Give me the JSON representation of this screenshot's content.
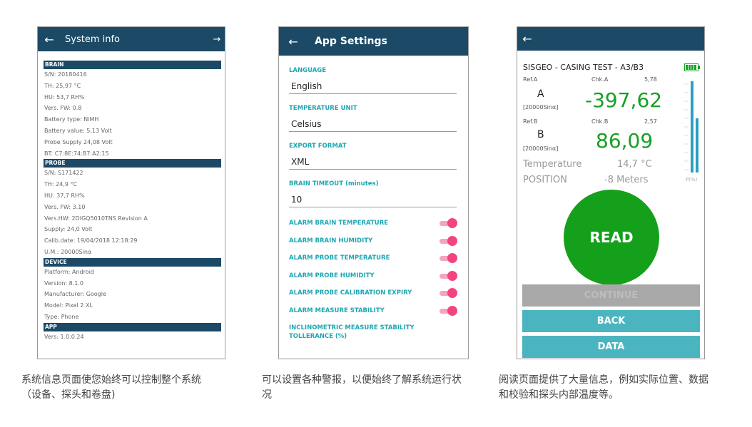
{
  "screen1": {
    "title": "System info",
    "back_icon": "arrow-left-icon",
    "forward_icon": "arrow-right-icon",
    "sections": [
      {
        "header": "BRAIN",
        "rows": [
          "S/N: 20180416",
          "TH: 25,97 °C",
          "HU: 53,7 RH%",
          "Vers. FW: 0.8",
          "Battery type: NiMH",
          "Battery value: 5,13 Volt",
          "Probe Supply 24,08 Volt",
          "BT: C7:8E:74:B7:A2:15"
        ]
      },
      {
        "header": "PROBE",
        "rows": [
          "S/N: S171422",
          "TH: 24,9 °C",
          "HU: 37,7 RH%",
          "Vers. FW: 3.10",
          "Vers.HW: 2DIGQ5010TNS Revision A",
          "Supply: 24,0 Volt",
          "Calib.date: 19/04/2018 12:18:29",
          "U.M.: 20000Sinα"
        ]
      },
      {
        "header": "DEVICE",
        "rows": [
          "Platform: Android",
          "Version: 8.1.0",
          "Manufacturer: Google",
          "Model: Pixel 2 XL",
          "Type: Phone"
        ]
      },
      {
        "header": "APP",
        "rows": [
          "Vers: 1.0.0.24"
        ]
      }
    ]
  },
  "screen2": {
    "title": "App Settings",
    "settings": [
      {
        "label": "LANGUAGE",
        "value": "English"
      },
      {
        "label": "TEMPERATURE UNIT",
        "value": "Celsius"
      },
      {
        "label": "EXPORT FORMAT",
        "value": "XML"
      },
      {
        "label": "BRAIN TIMEOUT (minutes)",
        "value": "10"
      }
    ],
    "alarms": [
      {
        "label": "ALARM BRAIN TEMPERATURE",
        "on": true
      },
      {
        "label": "ALARM BRAIN HUMIDITY",
        "on": true
      },
      {
        "label": "ALARM PROBE TEMPERATURE",
        "on": true
      },
      {
        "label": "ALARM PROBE HUMIDITY",
        "on": true
      },
      {
        "label": "ALARM PROBE CALIBRATION EXPIRY",
        "on": true
      },
      {
        "label": "ALARM MEASURE STABILITY",
        "on": true
      }
    ],
    "inclinometric_label": "INCLINOMETRIC MEASURE STABILITY TOLLERANCE (%)",
    "accent_color": "#1da7b3",
    "toggle_color": "#f2457f"
  },
  "screen3": {
    "header": "SISGEO - CASING TEST - A3/B3",
    "refA": "Ref.A",
    "chkA": "Chk.A",
    "chkA_val": "5,78",
    "axisA": "A",
    "unitA": "[20000Sinα]",
    "valA": "-397,62",
    "refB": "Ref.B",
    "chkB": "Chk.B",
    "chkB_val": "2,57",
    "axisB": "B",
    "unitB": "[20000Sinα]",
    "valB": "86,09",
    "temp_label": "Temperature",
    "temp_val": "14,7 °C",
    "pos_label": "POSITION",
    "pos_val": "-8 Meters",
    "gauge_label": "P(%)",
    "read_label": "READ",
    "continue_label": "CONTINUE",
    "back_label": "BACK",
    "data_label": "DATA",
    "green": "#15a01b",
    "teal": "#4bb5bf"
  },
  "captions": [
    "系统信息页面使您始终可以控制整个系统（设备、探头和卷盘)",
    "可以设置各种警报，以便始终了解系统运行状况",
    "阅读页面提供了大量信息，例如实际位置、数据和校验和探头内部温度等。"
  ]
}
